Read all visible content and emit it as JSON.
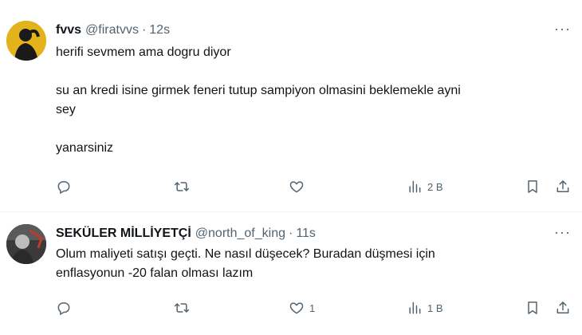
{
  "tweets": [
    {
      "name": "fvvs",
      "handle": "@firatvvs",
      "separator": "·",
      "time": "12s",
      "more": "···",
      "lines": [
        "herifi sevmem ama dogru diyor",
        "",
        "su an kredi isine girmek feneri tutup sampiyon olmasini beklemekle ayni",
        "sey",
        "",
        "yanarsiniz"
      ],
      "actions": {
        "replies": "",
        "retweets": "",
        "likes": "",
        "views": "2 B"
      }
    },
    {
      "name": "SEKÜLER MİLLİYETÇİ",
      "handle": "@north_of_king",
      "separator": "·",
      "time": "11s",
      "more": "···",
      "lines": [
        "Olum maliyeti satışı geçti. Ne nasıl düşecek? Buradan düşmesi için",
        "enflasyonun -20 falan olması lazım"
      ],
      "actions": {
        "replies": "",
        "retweets": "",
        "likes": "1",
        "views": "1 B"
      }
    }
  ],
  "colors": {
    "text": "#0f1419",
    "secondary": "#536471",
    "divider": "#eff3f4",
    "avatar1": "#e3b31c"
  },
  "icons": [
    "reply-icon",
    "retweet-icon",
    "like-icon",
    "views-icon",
    "bookmark-icon",
    "share-icon",
    "more-icon"
  ]
}
